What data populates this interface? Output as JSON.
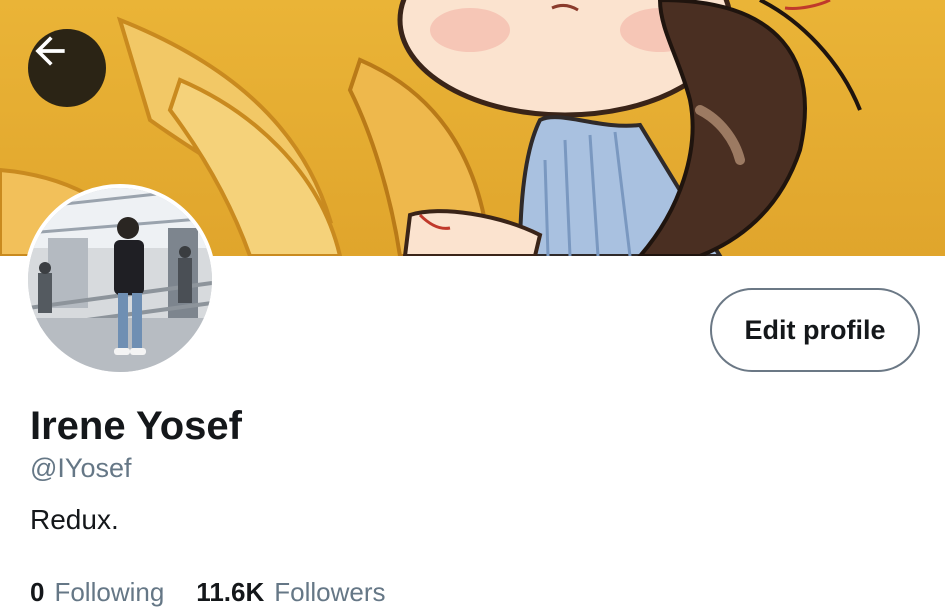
{
  "header": {
    "back_icon": "arrow-left-icon",
    "banner_colors": {
      "background": "#e8b135",
      "shirt": "#a9c1e0",
      "hair": "#4a2f22",
      "skin": "#fbe3cf"
    }
  },
  "profile": {
    "display_name": "Irene Yosef",
    "handle": "@IYosef",
    "bio": "Redux.",
    "edit_label": "Edit profile"
  },
  "stats": {
    "following_count": "0",
    "following_label": "Following",
    "followers_count": "11.6K",
    "followers_label": "Followers"
  },
  "colors": {
    "text_primary": "#14171a",
    "text_secondary": "#657786",
    "button_border": "#6b7885"
  }
}
